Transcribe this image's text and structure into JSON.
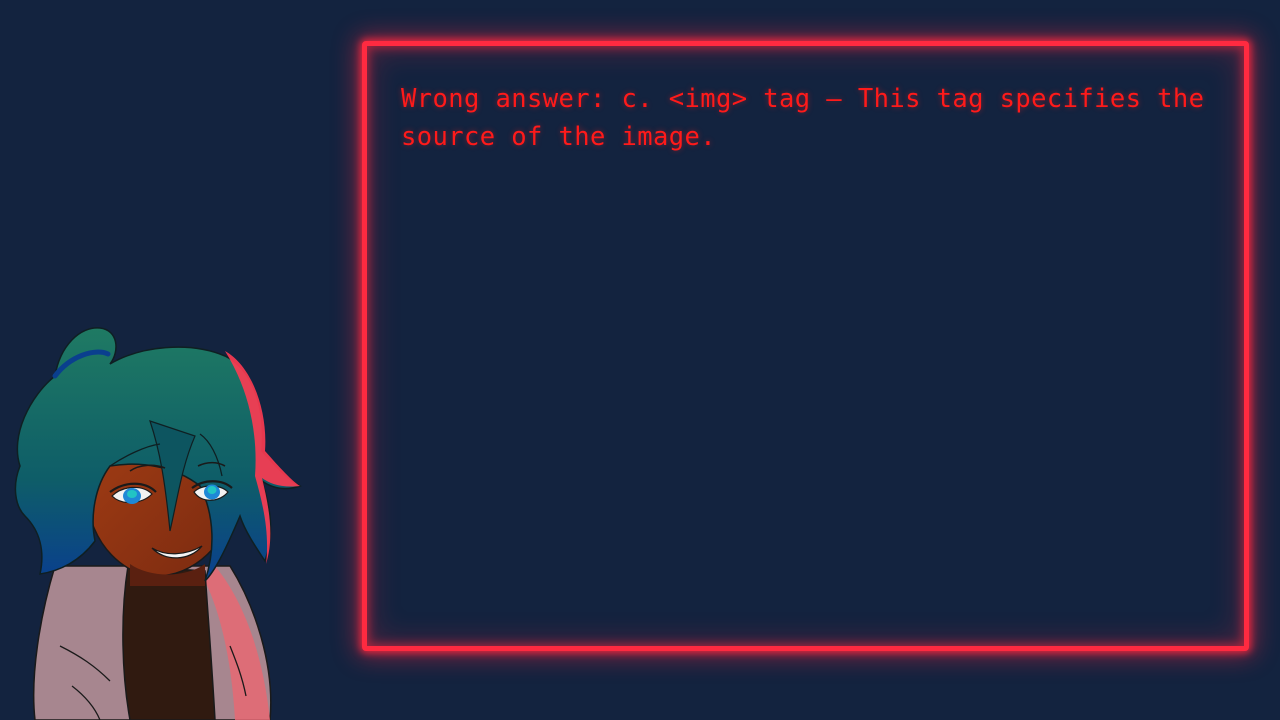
{
  "dialogue": {
    "text": "Wrong answer: c. <img> tag — This tag specifies the source of the image."
  },
  "colors": {
    "background": "#13233f",
    "neon_frame": "#ff2a40",
    "text": "#ff1a1a"
  },
  "character": {
    "icon": "character-portrait-icon"
  }
}
